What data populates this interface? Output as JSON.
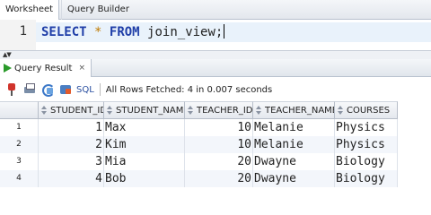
{
  "tabs": [
    {
      "label": "Worksheet",
      "active": true
    },
    {
      "label": "Query Builder",
      "active": false
    }
  ],
  "editor": {
    "line_number": "1",
    "tokens": {
      "select": "SELECT",
      "star": "*",
      "from": "FROM",
      "rest": "join_view;"
    }
  },
  "result_panel": {
    "tab_title": "Query Result",
    "tab_close": "×",
    "sql_label": "SQL",
    "status": "All Rows Fetched: 4 in 0.007 seconds"
  },
  "table": {
    "columns": [
      "STUDENT_ID",
      "STUDENT_NAME",
      "TEACHER_ID",
      "TEACHER_NAME",
      "COURSES"
    ],
    "rows": [
      {
        "n": "1",
        "student_id": "1",
        "student_name": "Max",
        "teacher_id": "10",
        "teacher_name": "Melanie",
        "courses": "Physics"
      },
      {
        "n": "2",
        "student_id": "2",
        "student_name": "Kim",
        "teacher_id": "10",
        "teacher_name": "Melanie",
        "courses": "Physics"
      },
      {
        "n": "3",
        "student_id": "3",
        "student_name": "Mia",
        "teacher_id": "20",
        "teacher_name": "Dwayne",
        "courses": "Biology"
      },
      {
        "n": "4",
        "student_id": "4",
        "student_name": "Bob",
        "teacher_id": "20",
        "teacher_name": "Dwayne",
        "courses": "Biology"
      }
    ]
  },
  "colors": {
    "keyword": "#1f3ea8",
    "star": "#c07a00",
    "run_icon": "#2a9a2a",
    "line_highlight": "#e9f2fb"
  },
  "icons": [
    "run-result-icon",
    "pin-icon",
    "print-icon",
    "refresh-icon",
    "sql-icon",
    "sort-icon"
  ]
}
